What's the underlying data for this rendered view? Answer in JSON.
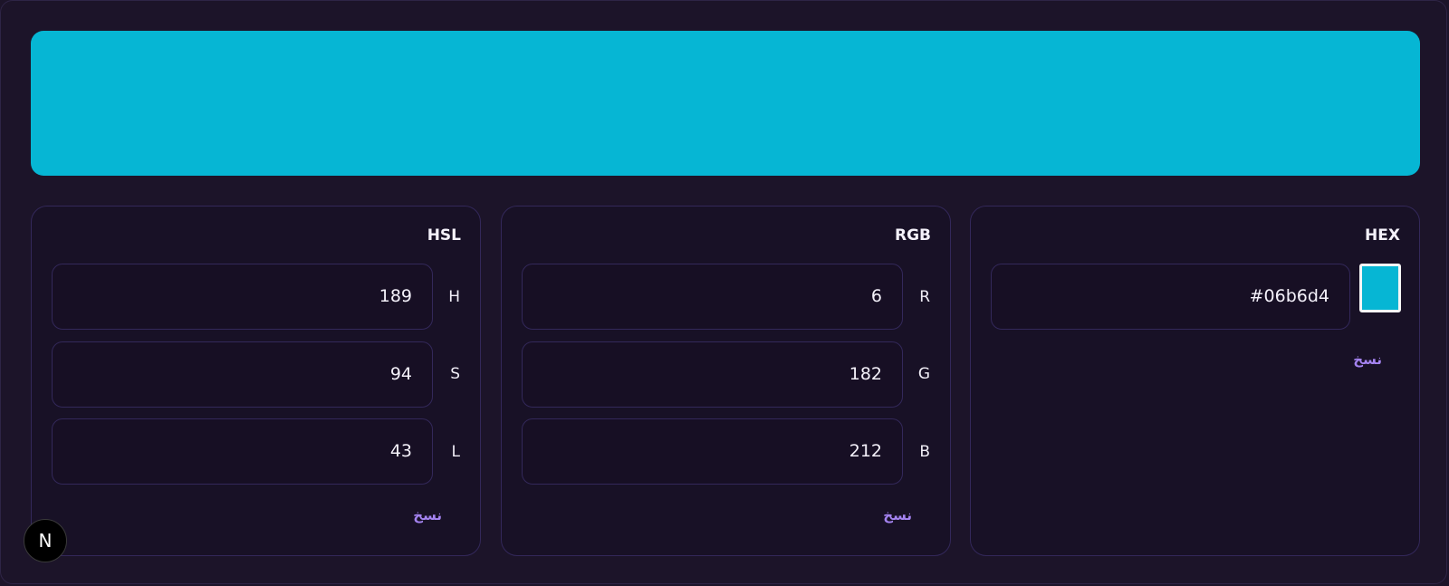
{
  "color": {
    "hex_value": "#06b6d4",
    "preview_color": "#06b6d4"
  },
  "hsl": {
    "title": "HSL",
    "h": {
      "label": "H",
      "value": "189"
    },
    "s": {
      "label": "S",
      "value": "94"
    },
    "l": {
      "label": "L",
      "value": "43"
    },
    "copy_label": "نسخ"
  },
  "rgb": {
    "title": "RGB",
    "r": {
      "label": "R",
      "value": "6"
    },
    "g": {
      "label": "G",
      "value": "182"
    },
    "b": {
      "label": "B",
      "value": "212"
    },
    "copy_label": "نسخ"
  },
  "hex": {
    "title": "HEX",
    "value": "#06b6d4",
    "copy_label": "نسخ"
  },
  "badge": {
    "letter": "N"
  }
}
